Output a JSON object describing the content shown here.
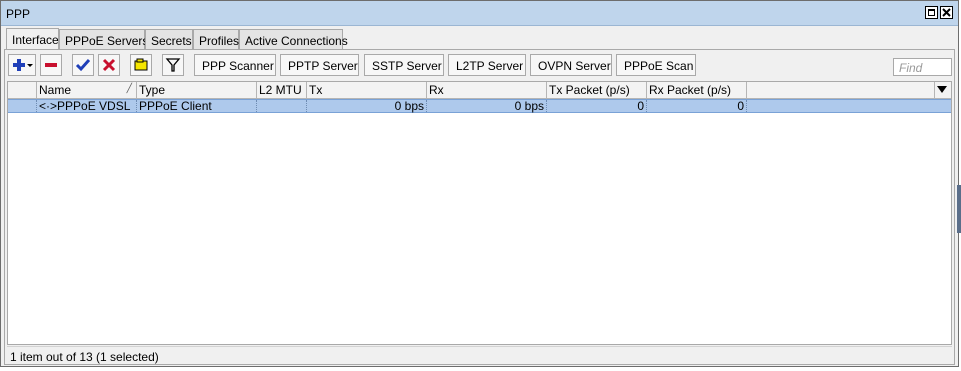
{
  "window": {
    "title": "PPP"
  },
  "tabs": [
    {
      "label": "Interface",
      "active": true
    },
    {
      "label": "PPPoE Servers",
      "active": false
    },
    {
      "label": "Secrets",
      "active": false
    },
    {
      "label": "Profiles",
      "active": false
    },
    {
      "label": "Active Connections",
      "active": false
    }
  ],
  "toolbar": {
    "icons": [
      "add-icon",
      "remove-icon",
      "enable-icon",
      "disable-icon",
      "comment-icon",
      "filter-icon"
    ],
    "buttons": [
      "PPP Scanner",
      "PPTP Server",
      "SSTP Server",
      "L2TP Server",
      "OVPN Server",
      "PPPoE Scan"
    ],
    "find_placeholder": "Find"
  },
  "table": {
    "columns": [
      "Name",
      "Type",
      "L2 MTU",
      "Tx",
      "Rx",
      "Tx Packet (p/s)",
      "Rx Packet (p/s)"
    ],
    "rows": [
      {
        "flag": "",
        "name": "<·>PPPoE VDSL",
        "type": "PPPoE Client",
        "l2mtu": "",
        "tx": "0 bps",
        "rx": "0 bps",
        "tx_packet": "0",
        "rx_packet": "0",
        "selected": true
      }
    ]
  },
  "status": "1 item out of 13 (1 selected)",
  "colors": {
    "titlebar": "#bfd5ec",
    "selection": "#aec9ec",
    "add": "#1f3fb8",
    "remove": "#c8102e",
    "enable": "#1f3fb8",
    "disable": "#c8102e",
    "comment": "#f5e600"
  }
}
